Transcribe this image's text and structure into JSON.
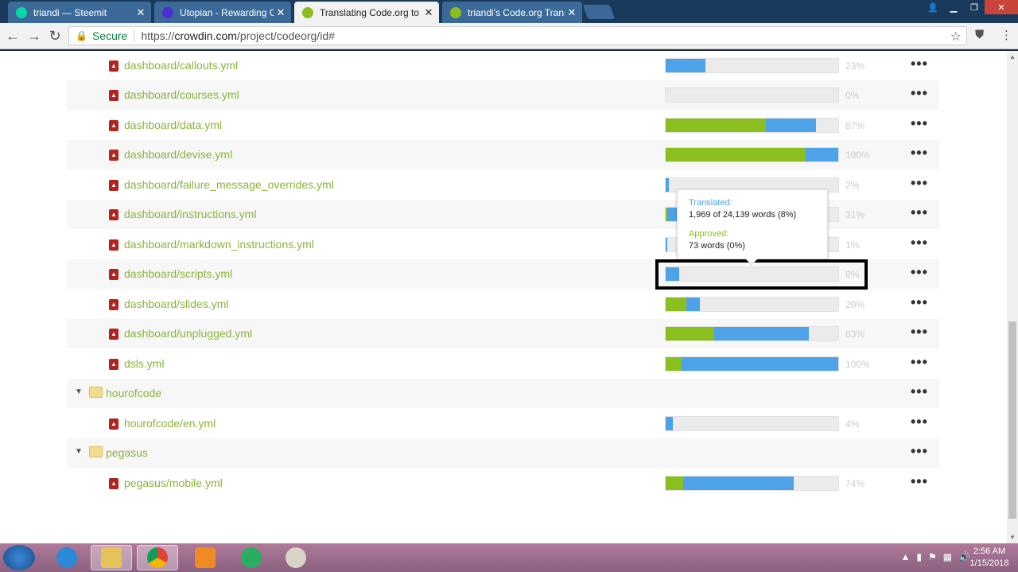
{
  "browser": {
    "tabs": [
      {
        "title": "triandi — Steemit",
        "favicon_color": "#06d6a9",
        "active": false
      },
      {
        "title": "Utopian - Rewarding Op",
        "favicon_color": "#4b2fd1",
        "active": false
      },
      {
        "title": "Translating Code.org to I",
        "favicon_color": "#8bbe1f",
        "active": true
      },
      {
        "title": "triandi's Code.org Transl",
        "favicon_color": "#8bbe1f",
        "active": false
      }
    ],
    "secure_label": "Secure",
    "url_scheme": "https://",
    "url_host": "crowdin.com",
    "url_path": "/project/codeorg/id#"
  },
  "files": [
    {
      "name": "dashboard/callouts.yml",
      "approved": 0,
      "translated": 23,
      "pct_label": "23%"
    },
    {
      "name": "dashboard/courses.yml",
      "approved": 0,
      "translated": 0,
      "pct_label": "0%"
    },
    {
      "name": "dashboard/data.yml",
      "approved": 58,
      "translated": 29,
      "pct_label": "87%"
    },
    {
      "name": "dashboard/devise.yml",
      "approved": 81,
      "translated": 19,
      "pct_label": "100%"
    },
    {
      "name": "dashboard/failure_message_overrides.yml",
      "approved": 0,
      "translated": 2,
      "pct_label": "2%"
    },
    {
      "name": "dashboard/instructions.yml",
      "approved": 1,
      "translated": 30,
      "pct_label": "31%"
    },
    {
      "name": "dashboard/markdown_instructions.yml",
      "approved": 0,
      "translated": 1,
      "pct_label": "1%"
    },
    {
      "name": "dashboard/scripts.yml",
      "approved": 0,
      "translated": 8,
      "pct_label": "8%"
    },
    {
      "name": "dashboard/slides.yml",
      "approved": 12,
      "translated": 8,
      "pct_label": "20%"
    },
    {
      "name": "dashboard/unplugged.yml",
      "approved": 28,
      "translated": 55,
      "pct_label": "83%"
    },
    {
      "name": "dsls.yml",
      "approved": 9,
      "translated": 91,
      "pct_label": "100%"
    },
    {
      "folder": "hourofcode"
    },
    {
      "name": "hourofcode/en.yml",
      "approved": 0,
      "translated": 4,
      "pct_label": "4%"
    },
    {
      "folder": "pegasus"
    },
    {
      "name": "pegasus/mobile.yml",
      "approved": 10,
      "translated": 64,
      "pct_label": "74%"
    }
  ],
  "tooltip": {
    "translated_label": "Translated:",
    "translated_value": "1,969 of 24,139 words (8%)",
    "approved_label": "Approved:",
    "approved_value": "73 words (0%)"
  },
  "colors": {
    "approved": "#8bbe1f",
    "translated": "#4da2e8",
    "link": "#8ab33a"
  },
  "clock": {
    "time": "2:56 AM",
    "date": "1/15/2018"
  }
}
